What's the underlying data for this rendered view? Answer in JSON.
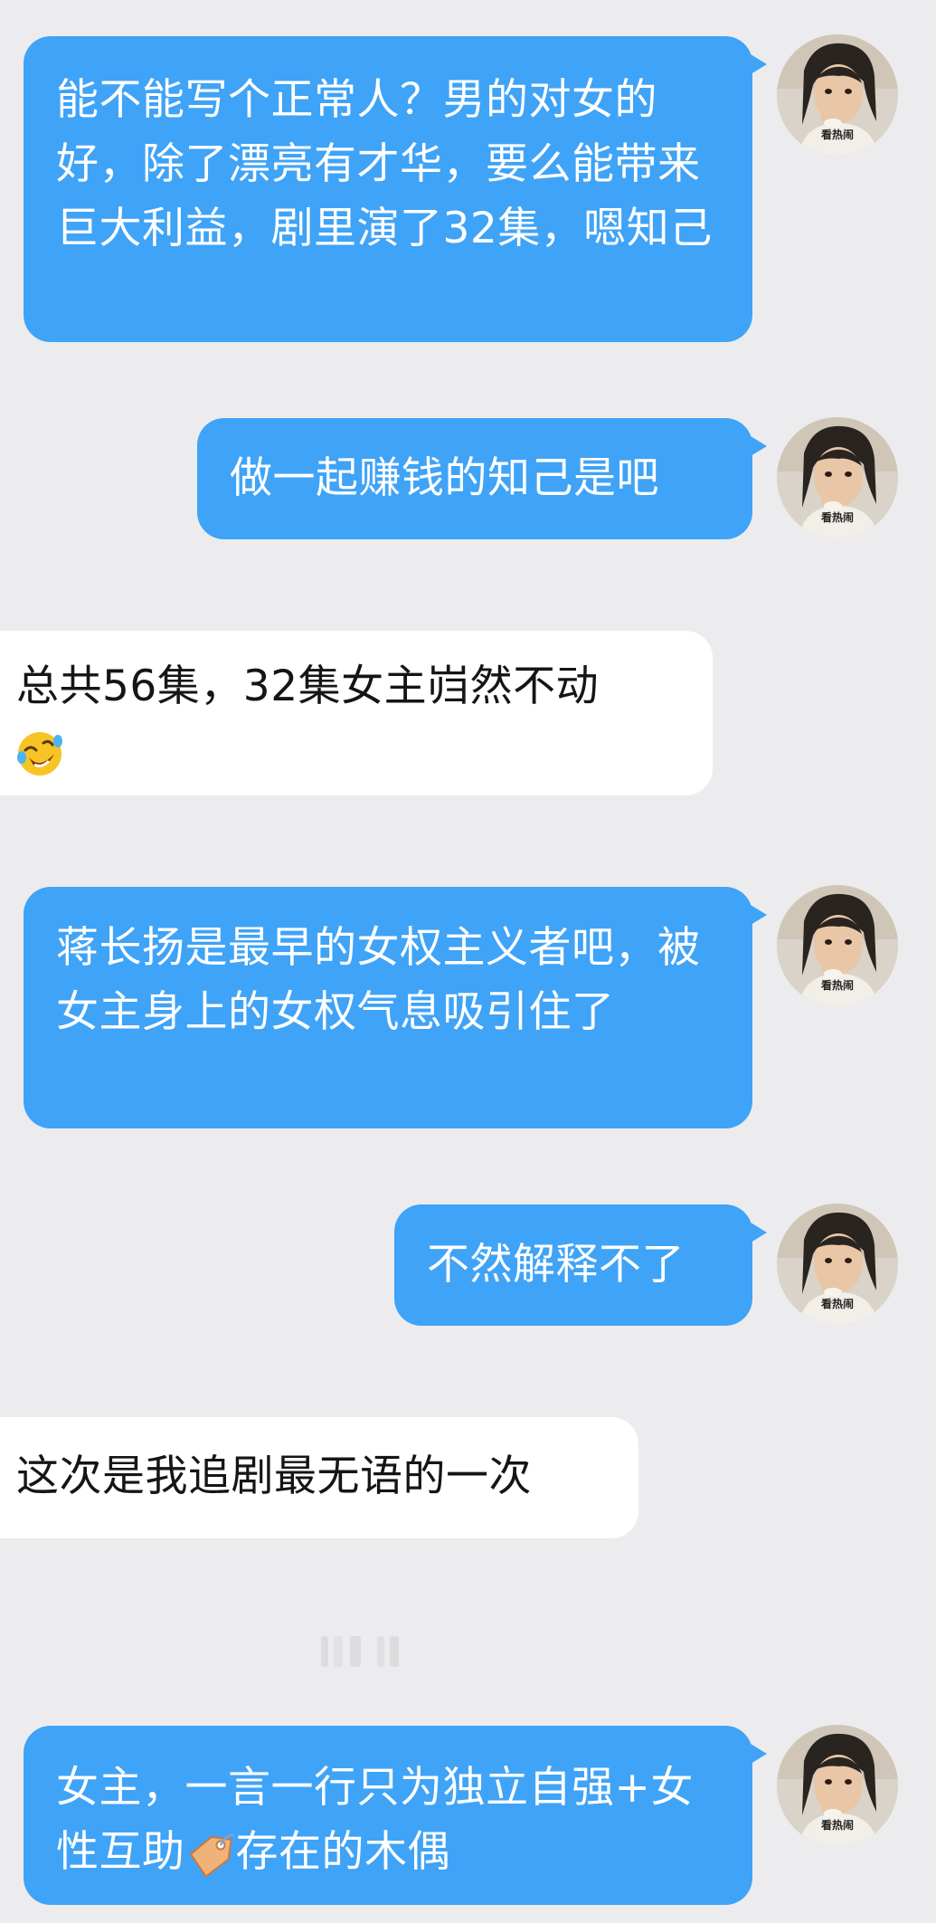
{
  "messages": [
    {
      "id": "m1",
      "side": "sent",
      "text": "能不能写个正常人？男的对女的好，除了漂亮有才华，要么能带来巨大利益，剧里演了32集，嗯知己"
    },
    {
      "id": "m2",
      "side": "sent",
      "text": "做一起赚钱的知己是吧"
    },
    {
      "id": "m3",
      "side": "recv",
      "text": "总共56集，32集女主岿然不动",
      "emoji": "rolling-on-floor-laughing"
    },
    {
      "id": "m4",
      "side": "sent",
      "text": "蒋长扬是最早的女权主义者吧，被女主身上的女权气息吸引住了"
    },
    {
      "id": "m5",
      "side": "sent",
      "text": "不然解释不了"
    },
    {
      "id": "m6",
      "side": "recv",
      "text": "这次是我追剧最无语的一次"
    },
    {
      "id": "m7",
      "side": "sent",
      "text_before": "女主，一言一行只为独立自强+女性互助",
      "emoji": "label-tag",
      "text_after": "存在的木偶"
    }
  ],
  "avatar": {
    "caption": "看热闹",
    "icon": "avatar-photo"
  },
  "colors": {
    "background": "#ececee",
    "sent_bubble": "#3fa3f7",
    "recv_bubble": "#ffffff",
    "sent_text": "#ffffff",
    "recv_text": "#151515"
  }
}
